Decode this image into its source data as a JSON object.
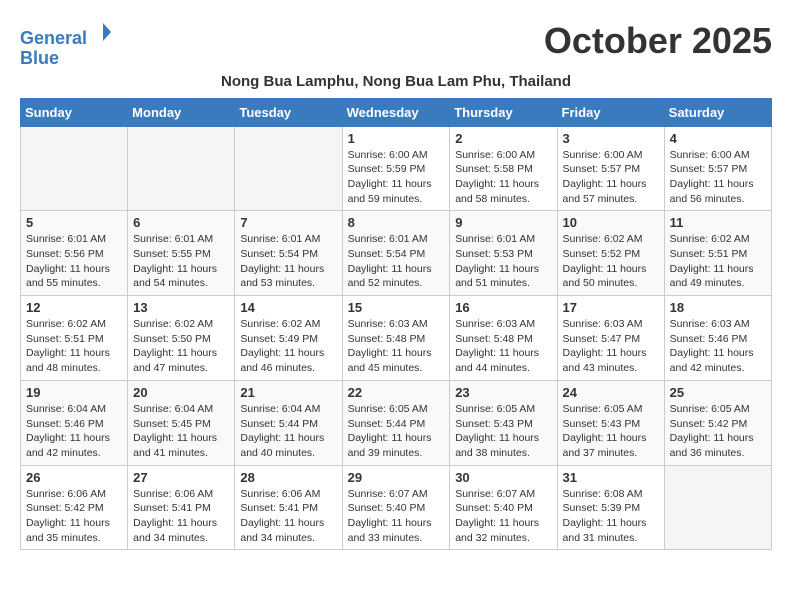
{
  "logo": {
    "line1": "General",
    "line2": "Blue"
  },
  "title": "October 2025",
  "subtitle": "Nong Bua Lamphu, Nong Bua Lam Phu, Thailand",
  "weekdays": [
    "Sunday",
    "Monday",
    "Tuesday",
    "Wednesday",
    "Thursday",
    "Friday",
    "Saturday"
  ],
  "weeks": [
    [
      {
        "day": "",
        "info": ""
      },
      {
        "day": "",
        "info": ""
      },
      {
        "day": "",
        "info": ""
      },
      {
        "day": "1",
        "info": "Sunrise: 6:00 AM\nSunset: 5:59 PM\nDaylight: 11 hours\nand 59 minutes."
      },
      {
        "day": "2",
        "info": "Sunrise: 6:00 AM\nSunset: 5:58 PM\nDaylight: 11 hours\nand 58 minutes."
      },
      {
        "day": "3",
        "info": "Sunrise: 6:00 AM\nSunset: 5:57 PM\nDaylight: 11 hours\nand 57 minutes."
      },
      {
        "day": "4",
        "info": "Sunrise: 6:00 AM\nSunset: 5:57 PM\nDaylight: 11 hours\nand 56 minutes."
      }
    ],
    [
      {
        "day": "5",
        "info": "Sunrise: 6:01 AM\nSunset: 5:56 PM\nDaylight: 11 hours\nand 55 minutes."
      },
      {
        "day": "6",
        "info": "Sunrise: 6:01 AM\nSunset: 5:55 PM\nDaylight: 11 hours\nand 54 minutes."
      },
      {
        "day": "7",
        "info": "Sunrise: 6:01 AM\nSunset: 5:54 PM\nDaylight: 11 hours\nand 53 minutes."
      },
      {
        "day": "8",
        "info": "Sunrise: 6:01 AM\nSunset: 5:54 PM\nDaylight: 11 hours\nand 52 minutes."
      },
      {
        "day": "9",
        "info": "Sunrise: 6:01 AM\nSunset: 5:53 PM\nDaylight: 11 hours\nand 51 minutes."
      },
      {
        "day": "10",
        "info": "Sunrise: 6:02 AM\nSunset: 5:52 PM\nDaylight: 11 hours\nand 50 minutes."
      },
      {
        "day": "11",
        "info": "Sunrise: 6:02 AM\nSunset: 5:51 PM\nDaylight: 11 hours\nand 49 minutes."
      }
    ],
    [
      {
        "day": "12",
        "info": "Sunrise: 6:02 AM\nSunset: 5:51 PM\nDaylight: 11 hours\nand 48 minutes."
      },
      {
        "day": "13",
        "info": "Sunrise: 6:02 AM\nSunset: 5:50 PM\nDaylight: 11 hours\nand 47 minutes."
      },
      {
        "day": "14",
        "info": "Sunrise: 6:02 AM\nSunset: 5:49 PM\nDaylight: 11 hours\nand 46 minutes."
      },
      {
        "day": "15",
        "info": "Sunrise: 6:03 AM\nSunset: 5:48 PM\nDaylight: 11 hours\nand 45 minutes."
      },
      {
        "day": "16",
        "info": "Sunrise: 6:03 AM\nSunset: 5:48 PM\nDaylight: 11 hours\nand 44 minutes."
      },
      {
        "day": "17",
        "info": "Sunrise: 6:03 AM\nSunset: 5:47 PM\nDaylight: 11 hours\nand 43 minutes."
      },
      {
        "day": "18",
        "info": "Sunrise: 6:03 AM\nSunset: 5:46 PM\nDaylight: 11 hours\nand 42 minutes."
      }
    ],
    [
      {
        "day": "19",
        "info": "Sunrise: 6:04 AM\nSunset: 5:46 PM\nDaylight: 11 hours\nand 42 minutes."
      },
      {
        "day": "20",
        "info": "Sunrise: 6:04 AM\nSunset: 5:45 PM\nDaylight: 11 hours\nand 41 minutes."
      },
      {
        "day": "21",
        "info": "Sunrise: 6:04 AM\nSunset: 5:44 PM\nDaylight: 11 hours\nand 40 minutes."
      },
      {
        "day": "22",
        "info": "Sunrise: 6:05 AM\nSunset: 5:44 PM\nDaylight: 11 hours\nand 39 minutes."
      },
      {
        "day": "23",
        "info": "Sunrise: 6:05 AM\nSunset: 5:43 PM\nDaylight: 11 hours\nand 38 minutes."
      },
      {
        "day": "24",
        "info": "Sunrise: 6:05 AM\nSunset: 5:43 PM\nDaylight: 11 hours\nand 37 minutes."
      },
      {
        "day": "25",
        "info": "Sunrise: 6:05 AM\nSunset: 5:42 PM\nDaylight: 11 hours\nand 36 minutes."
      }
    ],
    [
      {
        "day": "26",
        "info": "Sunrise: 6:06 AM\nSunset: 5:42 PM\nDaylight: 11 hours\nand 35 minutes."
      },
      {
        "day": "27",
        "info": "Sunrise: 6:06 AM\nSunset: 5:41 PM\nDaylight: 11 hours\nand 34 minutes."
      },
      {
        "day": "28",
        "info": "Sunrise: 6:06 AM\nSunset: 5:41 PM\nDaylight: 11 hours\nand 34 minutes."
      },
      {
        "day": "29",
        "info": "Sunrise: 6:07 AM\nSunset: 5:40 PM\nDaylight: 11 hours\nand 33 minutes."
      },
      {
        "day": "30",
        "info": "Sunrise: 6:07 AM\nSunset: 5:40 PM\nDaylight: 11 hours\nand 32 minutes."
      },
      {
        "day": "31",
        "info": "Sunrise: 6:08 AM\nSunset: 5:39 PM\nDaylight: 11 hours\nand 31 minutes."
      },
      {
        "day": "",
        "info": ""
      }
    ]
  ]
}
